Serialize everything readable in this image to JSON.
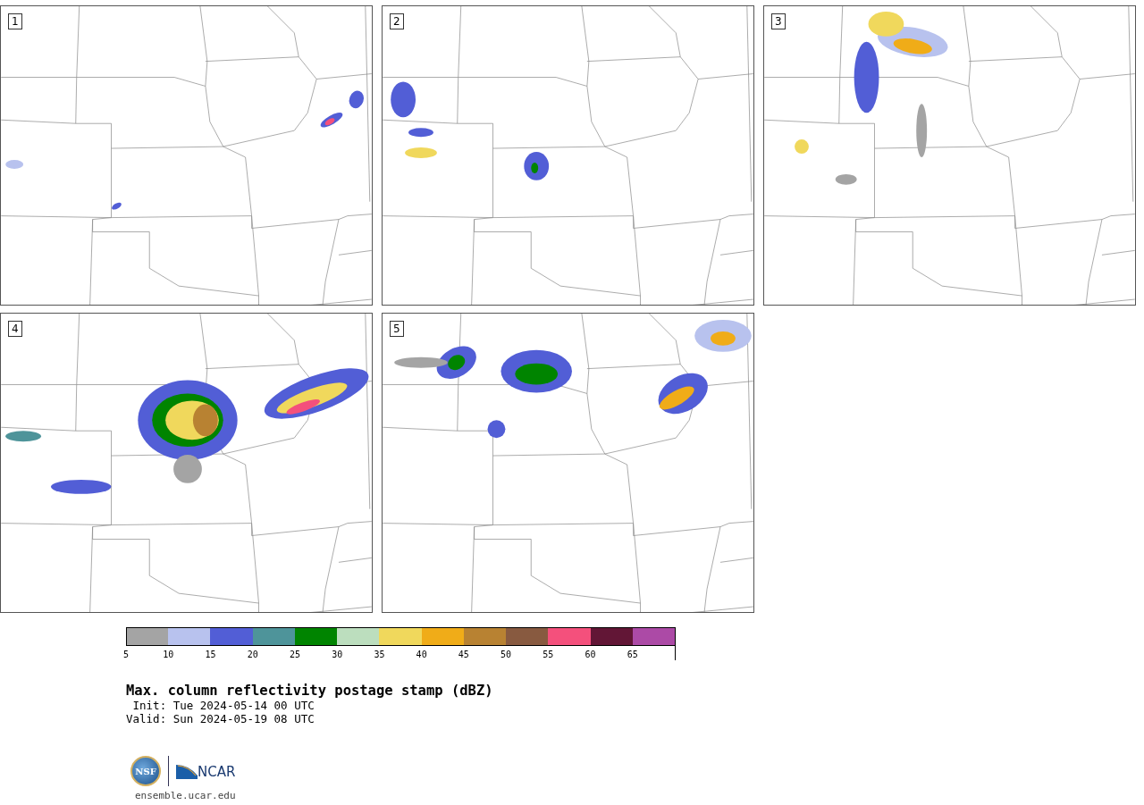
{
  "panels": [
    {
      "number": "1"
    },
    {
      "number": "2"
    },
    {
      "number": "3"
    },
    {
      "number": "4"
    },
    {
      "number": "5"
    }
  ],
  "colorbar": {
    "segments": [
      {
        "color": "#a4a4a4"
      },
      {
        "color": "#b8c2ee"
      },
      {
        "color": "#525ed6"
      },
      {
        "color": "#4e949a"
      },
      {
        "color": "#008400"
      },
      {
        "color": "#bcdebe"
      },
      {
        "color": "#f0d85c"
      },
      {
        "color": "#f0ac18"
      },
      {
        "color": "#b88232"
      },
      {
        "color": "#885a40"
      },
      {
        "color": "#f4507c"
      },
      {
        "color": "#621636"
      },
      {
        "color": "#ac4aa6"
      }
    ],
    "ticks": [
      "5",
      "10",
      "15",
      "20",
      "25",
      "30",
      "35",
      "40",
      "45",
      "50",
      "55",
      "60",
      "65"
    ]
  },
  "title": "Max. column reflectivity postage stamp (dBZ)",
  "init": " Init: Tue 2024-05-14 00 UTC",
  "valid": "Valid: Sun 2024-05-19 08 UTC",
  "logo": {
    "nsf": "NSF",
    "ncar": "NCAR"
  },
  "url": "ensemble.ucar.edu"
}
